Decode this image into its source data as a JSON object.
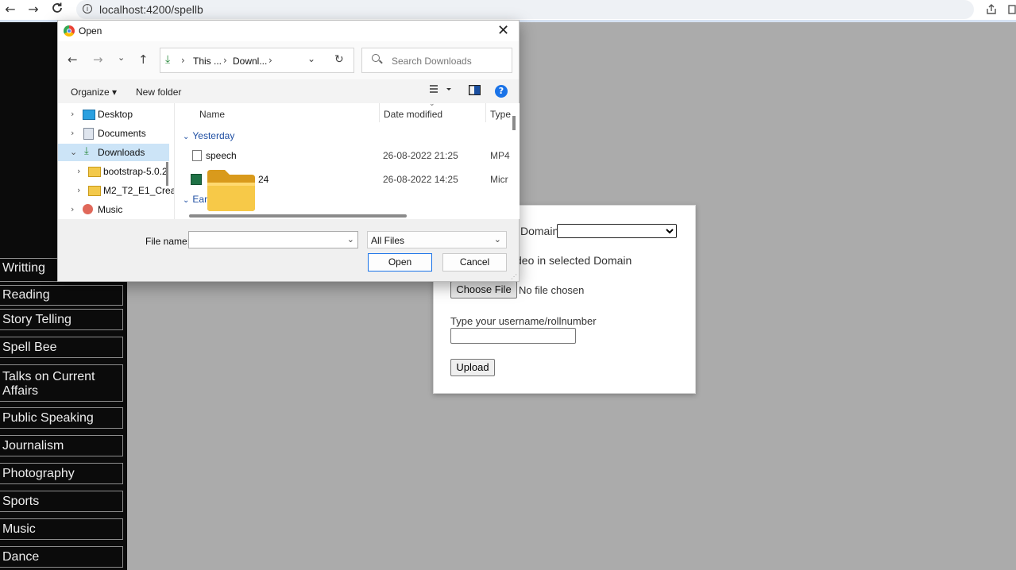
{
  "browser": {
    "back_glyph": "←",
    "forward_glyph": "→",
    "reload_glyph": "C",
    "info_glyph": "i",
    "url": "localhost:4200/spellb"
  },
  "sidebar": {
    "items": [
      {
        "label": "Writting"
      },
      {
        "label": "Reading"
      },
      {
        "label": "Story Telling"
      },
      {
        "label": "Spell Bee"
      },
      {
        "label": "Talks on Current Affairs"
      },
      {
        "label": "Public Speaking"
      },
      {
        "label": "Journalism"
      },
      {
        "label": "Photography"
      },
      {
        "label": "Sports"
      },
      {
        "label": "Music"
      },
      {
        "label": "Dance"
      }
    ]
  },
  "form": {
    "domain_label": "Domain",
    "domain_value": "",
    "video_label": "deo in selected Domain",
    "choose_file_label": "Choose File",
    "no_file_text": "No file chosen",
    "username_label": "Type your username/rollnumber",
    "username_value": "",
    "upload_label": "Upload"
  },
  "dialog": {
    "title": "Open",
    "close_glyph": "✕",
    "path": [
      "This ...",
      "Downl..."
    ],
    "search_placeholder": "Search Downloads",
    "organize_label": "Organize ▾",
    "new_folder_label": "New folder",
    "help_glyph": "?",
    "nav_items": [
      {
        "label": "Desktop",
        "expanded": false,
        "selected": false
      },
      {
        "label": "Documents",
        "expanded": false,
        "selected": false
      },
      {
        "label": "Downloads",
        "expanded": true,
        "selected": true
      },
      {
        "label": "bootstrap-5.0.2",
        "expanded": false,
        "selected": false
      },
      {
        "label": "M2_T2_E1_Crea",
        "expanded": false,
        "selected": false
      },
      {
        "label": "Music",
        "expanded": false,
        "selected": false
      }
    ],
    "columns": {
      "name": "Name",
      "date": "Date modified",
      "type": "Type"
    },
    "groups": [
      {
        "label": "Yesterday"
      },
      {
        "label": "Earl"
      }
    ],
    "files": [
      {
        "name": "speech",
        "date": "26-08-2022 21:25",
        "type": "MP4"
      },
      {
        "name": "24",
        "date": "26-08-2022 14:25",
        "type": "Micr"
      }
    ],
    "file_name_label": "File name:",
    "file_name_value": "",
    "file_type_value": "All Files",
    "open_label": "Open",
    "cancel_label": "Cancel"
  },
  "colors": {
    "page_bg": "#ababab",
    "sidebar_bg": "#0b0b0b",
    "accent": "#1a73e8",
    "nav_selected": "#cce4f7",
    "group_text": "#1f4fa3"
  }
}
